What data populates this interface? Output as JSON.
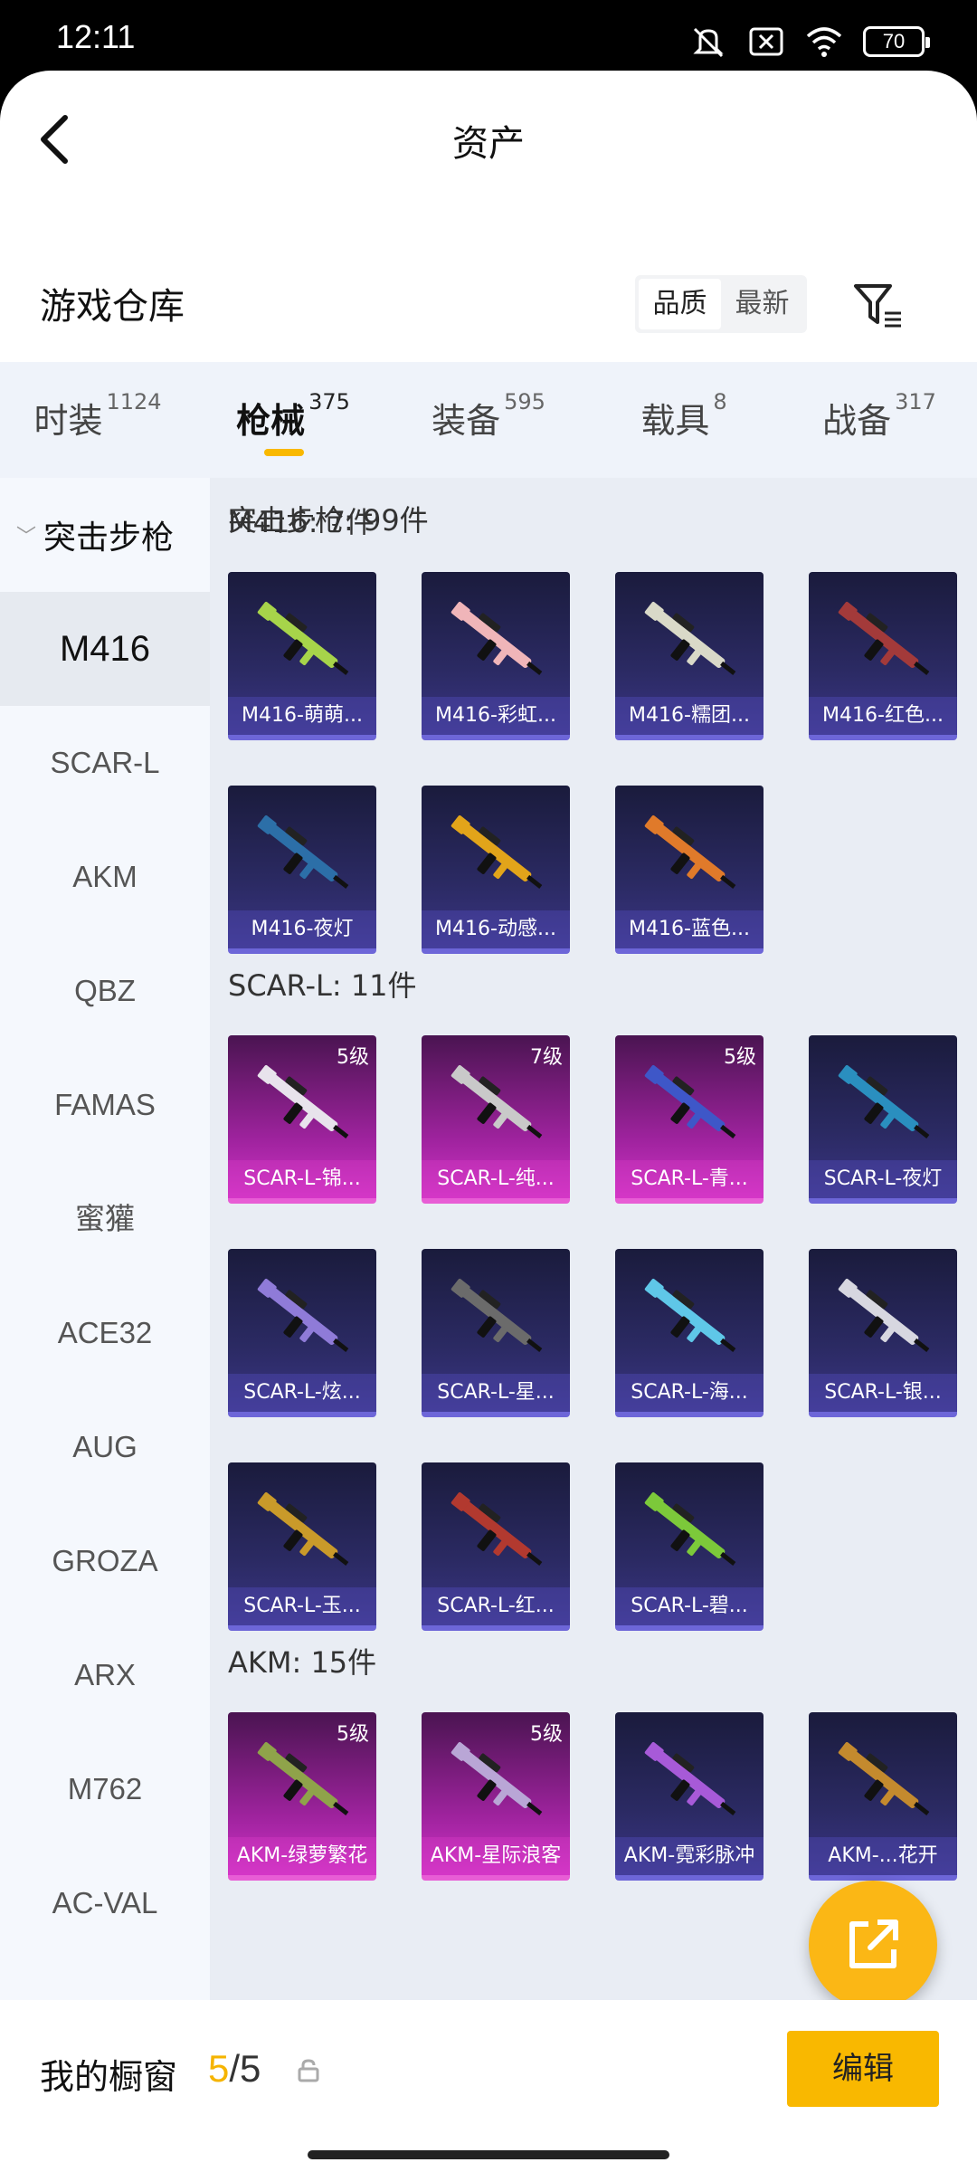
{
  "status": {
    "time": "12:11",
    "battery": "70"
  },
  "nav": {
    "title": "资产"
  },
  "warehouse": {
    "title": "游戏仓库",
    "sort_options": [
      "品质",
      "最新"
    ],
    "sort_active": "品质"
  },
  "tabs": [
    {
      "label": "时装",
      "count": "1124"
    },
    {
      "label": "枪械",
      "count": "375",
      "active": true
    },
    {
      "label": "装备",
      "count": "595"
    },
    {
      "label": "载具",
      "count": "8"
    },
    {
      "label": "战备",
      "count": "317"
    }
  ],
  "sidebar": {
    "header": "突击步枪",
    "items": [
      "M416",
      "SCAR-L",
      "AKM",
      "QBZ",
      "FAMAS",
      "蜜獾",
      "ACE32",
      "AUG",
      "GROZA",
      "ARX",
      "M762",
      "AC-VAL"
    ],
    "active": "M416"
  },
  "content": {
    "category_title": "突击步枪: 99件",
    "groups": [
      {
        "title": "M416: 7件",
        "items": [
          {
            "name": "M416-萌萌...",
            "rarity": "purple",
            "gun_color": "#a7d44a"
          },
          {
            "name": "M416-彩虹...",
            "rarity": "purple",
            "gun_color": "#f0b5b9"
          },
          {
            "name": "M416-糯团...",
            "rarity": "purple",
            "gun_color": "#d9d9c8"
          },
          {
            "name": "M416-红色...",
            "rarity": "purple",
            "gun_color": "#a33a3a"
          },
          {
            "name": "M416-夜灯",
            "rarity": "purple",
            "gun_color": "#2c6fa8"
          },
          {
            "name": "M416-动感...",
            "rarity": "purple",
            "gun_color": "#e2a41a"
          },
          {
            "name": "M416-蓝色...",
            "rarity": "purple",
            "gun_color": "#e07a2a"
          }
        ]
      },
      {
        "title": "SCAR-L: 11件",
        "items": [
          {
            "name": "SCAR-L-锦...",
            "rarity": "pink",
            "level": "5级",
            "gun_color": "#e8e3ec"
          },
          {
            "name": "SCAR-L-纯...",
            "rarity": "pink",
            "level": "7级",
            "gun_color": "#c9c9c9"
          },
          {
            "name": "SCAR-L-青...",
            "rarity": "pink",
            "level": "5级",
            "gun_color": "#3e57c8"
          },
          {
            "name": "SCAR-L-夜灯",
            "rarity": "purple",
            "gun_color": "#2a8fbf"
          },
          {
            "name": "SCAR-L-炫...",
            "rarity": "purple",
            "gun_color": "#8f7bd8"
          },
          {
            "name": "SCAR-L-星...",
            "rarity": "purple",
            "gun_color": "#6b6b6b"
          },
          {
            "name": "SCAR-L-海...",
            "rarity": "purple",
            "gun_color": "#5fc7e8"
          },
          {
            "name": "SCAR-L-银...",
            "rarity": "purple",
            "gun_color": "#d7d7e0"
          },
          {
            "name": "SCAR-L-玉...",
            "rarity": "purple",
            "gun_color": "#c99a2a"
          },
          {
            "name": "SCAR-L-红...",
            "rarity": "purple",
            "gun_color": "#b2392f"
          },
          {
            "name": "SCAR-L-碧...",
            "rarity": "purple",
            "gun_color": "#7cc93a"
          }
        ]
      },
      {
        "title": "AKM: 15件",
        "items": [
          {
            "name": "AKM-绿萝繁花",
            "rarity": "pink",
            "level": "5级",
            "gun_color": "#8fa34a"
          },
          {
            "name": "AKM-星际浪客",
            "rarity": "pink",
            "level": "5级",
            "gun_color": "#b9a6d6"
          },
          {
            "name": "AKM-霓彩脉冲",
            "rarity": "purple",
            "gun_color": "#a75ad8"
          },
          {
            "name": "AKM-...花开",
            "rarity": "purple",
            "gun_color": "#c48a2e"
          }
        ]
      }
    ]
  },
  "bottom": {
    "title": "我的橱窗",
    "current": "5",
    "total": "5",
    "edit_label": "编辑"
  }
}
